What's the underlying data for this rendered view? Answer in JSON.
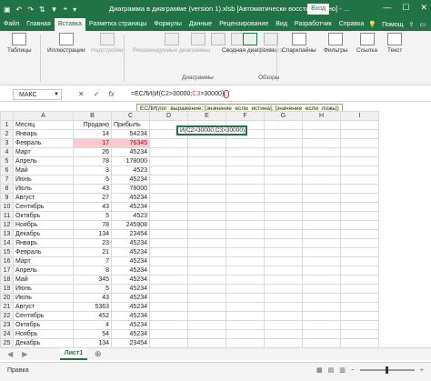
{
  "titlebar": {
    "title": "Диаграмма в диаграмме (version 1).xlsb [Автоматически восстановлено] - ...",
    "login": "Вход",
    "icons": [
      "save-icon",
      "undo-icon",
      "redo-icon",
      "sort-icon",
      "filter-icon",
      "pin-icon",
      "customize-icon"
    ],
    "window_controls": [
      "—",
      "☐",
      "✕"
    ]
  },
  "menu": {
    "tabs": [
      "Файл",
      "Главная",
      "Вставка",
      "Разметка страницы",
      "Формулы",
      "Данные",
      "Рецензирование",
      "Вид",
      "Разработчик",
      "Справка"
    ],
    "active_index": 2,
    "tell_me": "Помощ",
    "share_icon": "share-icon",
    "comment_icon": "comment-icon"
  },
  "ribbon": {
    "tables": "Таблицы",
    "illustrations": "Иллюстрации",
    "addins": "Надстройки",
    "recommended_charts": "Рекомендуемые диаграммы",
    "pivot_chart": "Сводная диаграмма",
    "map3d": "3D-карта",
    "sparklines": "Спарклайны",
    "filters": "Фильтры",
    "links": "Ссылка",
    "text": "Текст",
    "charts_group": "Диаграммы",
    "tours_group": "Обзоры"
  },
  "formula_bar": {
    "name_box": "МАКС",
    "formula_prefix": "=ЕСЛИ(И(C2>30000;",
    "formula_c3": "C3",
    "formula_mid": ">30000)",
    "formula_cursor": ";"
  },
  "tooltip": "ЕСЛИ(лог_выражение; [значение_если_истина]; [значение_если_ложь])",
  "edit_cell_text": "И(C2>30000;C3>30000);",
  "grid": {
    "columns": [
      "A",
      "B",
      "C",
      "D",
      "E",
      "F",
      "G",
      "H",
      "I"
    ],
    "headers": [
      "Месяц",
      "Продано",
      "Прибыль"
    ],
    "rows": [
      {
        "month": "Январь",
        "sold": "14",
        "profit": "54234"
      },
      {
        "month": "Февраль",
        "sold": "17",
        "profit": "76345"
      },
      {
        "month": "Март",
        "sold": "26",
        "profit": "45234"
      },
      {
        "month": "Апрель",
        "sold": "78",
        "profit": "178000"
      },
      {
        "month": "Май",
        "sold": "3",
        "profit": "4523"
      },
      {
        "month": "Июнь",
        "sold": "5",
        "profit": "45234"
      },
      {
        "month": "Июль",
        "sold": "43",
        "profit": "78000"
      },
      {
        "month": "Август",
        "sold": "27",
        "profit": "45234"
      },
      {
        "month": "Сентябрь",
        "sold": "43",
        "profit": "45234"
      },
      {
        "month": "Октябрь",
        "sold": "5",
        "profit": "4523"
      },
      {
        "month": "Ноябрь",
        "sold": "78",
        "profit": "245908"
      },
      {
        "month": "Декабрь",
        "sold": "134",
        "profit": "23454"
      },
      {
        "month": "Январь",
        "sold": "23",
        "profit": "45234"
      },
      {
        "month": "Февраль",
        "sold": "21",
        "profit": "45234"
      },
      {
        "month": "Март",
        "sold": "7",
        "profit": "45234"
      },
      {
        "month": "Апрель",
        "sold": "8",
        "profit": "45234"
      },
      {
        "month": "Май",
        "sold": "345",
        "profit": "45234"
      },
      {
        "month": "Июнь",
        "sold": "5",
        "profit": "45234"
      },
      {
        "month": "Июль",
        "sold": "43",
        "profit": "45234"
      },
      {
        "month": "Август",
        "sold": "5363",
        "profit": "45234"
      },
      {
        "month": "Сентябрь",
        "sold": "452",
        "profit": "45234"
      },
      {
        "month": "Октябрь",
        "sold": "4",
        "profit": "45234"
      },
      {
        "month": "Ноябрь",
        "sold": "54",
        "profit": "45234"
      },
      {
        "month": "Декабрь",
        "sold": "134",
        "profit": "23454"
      }
    ]
  },
  "sheet": {
    "tab": "Лист1"
  },
  "status": {
    "mode": "Правка",
    "zoom": "+"
  }
}
